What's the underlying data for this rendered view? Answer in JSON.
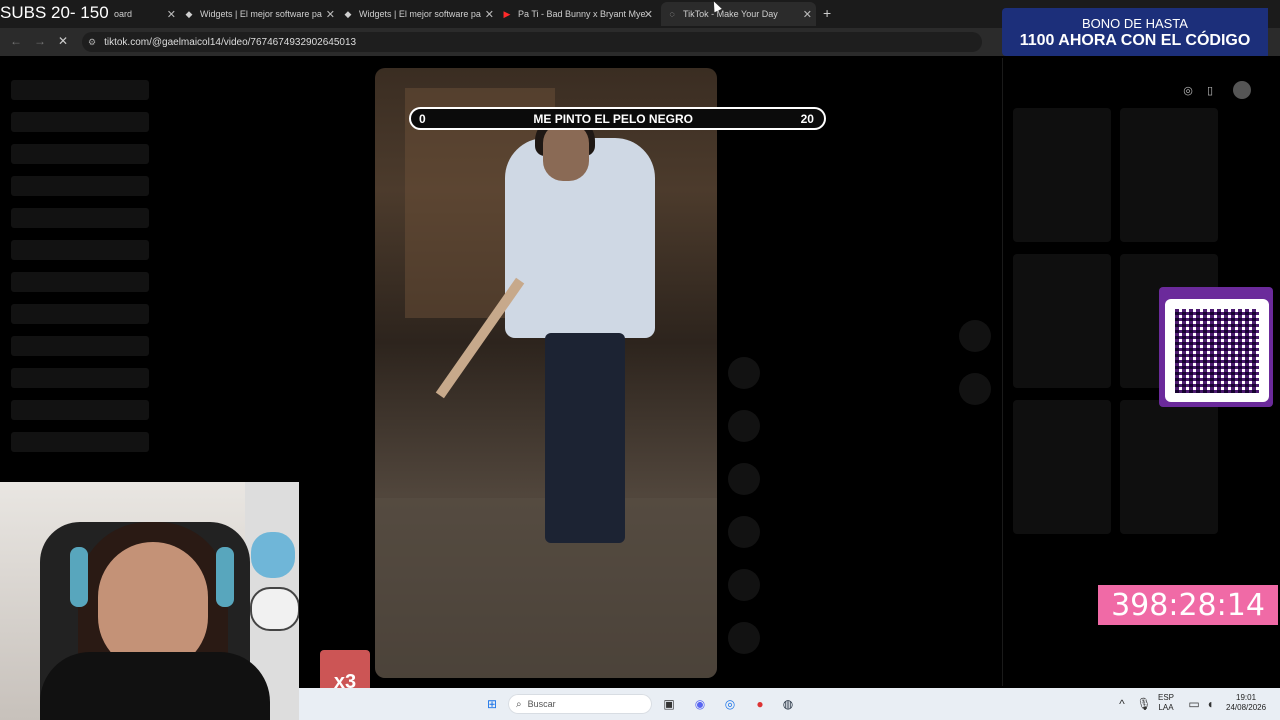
{
  "overlay": {
    "subs_text": "SUBS 20- 150"
  },
  "browser": {
    "tabs": [
      {
        "label": "oard",
        "icon": ""
      },
      {
        "label": "Widgets | El mejor software pa",
        "icon": "◆"
      },
      {
        "label": "Widgets | El mejor software pa",
        "icon": "◆"
      },
      {
        "label": "Pa Ti - Bad Bunny x Bryant Mye",
        "icon": "▶"
      },
      {
        "label": "TikTok - Make Your Day",
        "icon": "◌"
      }
    ],
    "url": "tiktok.com/@gaelmaicol14/video/7674674932902645013"
  },
  "promo": {
    "line1": "BONO DE HASTA",
    "line2": "1100 AHORA CON EL CÓDIGO"
  },
  "counter": {
    "left": "0",
    "title": "ME PINTO EL PELO NEGRO",
    "right": "20"
  },
  "timer": "398:28:14",
  "emote": {
    "multiplier": "x3"
  },
  "taskbar": {
    "search_placeholder": "Buscar",
    "lang_line1": "ESP",
    "lang_line2": "LAA",
    "time": "19:01",
    "date": "24/08/2026"
  }
}
